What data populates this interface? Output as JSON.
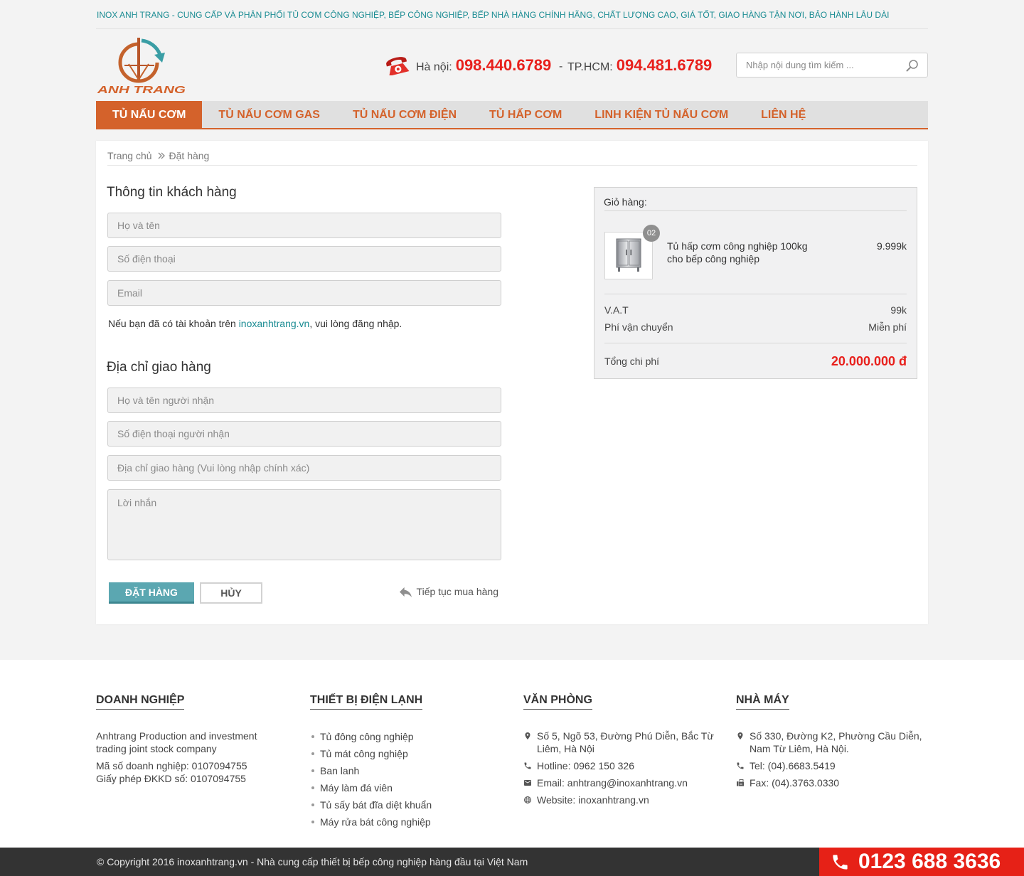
{
  "tagline": "INOX ANH TRANG - CUNG CẤP VÀ PHÂN PHỐI TỦ CƠM CÔNG NGHIỆP, BẾP CÔNG NGHIỆP, BẾP NHÀ HÀNG CHÍNH HÃNG, CHẤT LƯỢNG CAO, GIÁ TỐT, GIAO HÀNG TẬN NƠI, BẢO HÀNH LÂU DÀI",
  "logo": {
    "text": "ANH TRANG",
    "icon": "anh-trang-logo"
  },
  "header": {
    "phone_icon": "red-telephone-icon",
    "hotlines": [
      {
        "label": "Hà nội:",
        "number": "098.440.6789"
      },
      {
        "label": "TP.HCM:",
        "number": "094.481.6789"
      }
    ],
    "separator": "-",
    "search": {
      "placeholder": "Nhập nội dung tìm kiếm ...",
      "value": "",
      "icon": "search-icon"
    }
  },
  "nav": {
    "items": [
      {
        "label": "TỦ NẤU CƠM",
        "active": true
      },
      {
        "label": "TỦ NẤU CƠM GAS",
        "active": false
      },
      {
        "label": "TỦ NẤU CƠM ĐIỆN",
        "active": false
      },
      {
        "label": "TỦ HẤP CƠM",
        "active": false
      },
      {
        "label": "LINH KIỆN TỦ NẤU CƠM",
        "active": false
      },
      {
        "label": "LIÊN HỆ",
        "active": false
      }
    ]
  },
  "breadcrumb": {
    "items": [
      "Trang chủ",
      "Đặt hàng"
    ],
    "separator_icon": "double-chevron-right-icon"
  },
  "customer_info": {
    "title": "Thông tin khách hàng",
    "fields": [
      {
        "placeholder": "Họ và tên",
        "value": ""
      },
      {
        "placeholder": "Số điện thoại",
        "value": ""
      },
      {
        "placeholder": "Email",
        "value": ""
      }
    ],
    "login_note": {
      "before": "Nếu bạn đã có tài khoản trên ",
      "link": "inoxanhtrang.vn",
      "after": ", vui lòng đăng nhập."
    }
  },
  "shipping_address": {
    "title": "Địa chỉ giao hàng",
    "fields": [
      {
        "placeholder": "Họ và tên người nhận",
        "value": ""
      },
      {
        "placeholder": "Số điện thoại người nhận",
        "value": ""
      },
      {
        "placeholder": "Địa chỉ giao hàng (Vui lòng nhập chính xác)",
        "value": ""
      },
      {
        "placeholder": "Lời nhắn",
        "value": ""
      }
    ]
  },
  "actions": {
    "order_label": "ĐẶT HÀNG",
    "cancel_label": "HỦY",
    "continue_label": "Tiếp tục mua hàng",
    "continue_icon": "reply-arrow-icon"
  },
  "cart": {
    "title": "Giỏ hàng:",
    "items": [
      {
        "quantity": "02",
        "name": "Tủ hấp cơm công nghiệp 100kg cho bếp công nghiệp",
        "price": "9.999k",
        "image_icon": "steamer-cabinet-icon"
      }
    ],
    "summary": [
      {
        "label": "V.A.T",
        "value": "99k"
      },
      {
        "label": "Phí vận chuyển",
        "value": "Miễn phí"
      }
    ],
    "total": {
      "label": "Tổng chi phí",
      "value": "20.000.000 đ"
    }
  },
  "footer": {
    "company": {
      "title": "DOANH NGHIỆP",
      "name": "Anhtrang Production and investment trading joint stock company",
      "tax_code": "Mã số doanh nghiệp: 0107094755",
      "license": "Giấy phép ĐKKD số: 0107094755"
    },
    "refrigeration": {
      "title": "THIẾT BỊ ĐIỆN LẠNH",
      "items": [
        "Tủ đông công nghiệp",
        "Tủ mát công nghiệp",
        "Ban lanh",
        "Máy làm đá viên",
        "Tủ sấy bát đĩa diệt khuẩn",
        "Máy rửa bát công nghiệp"
      ]
    },
    "office": {
      "title": "VĂN PHÒNG",
      "items": [
        {
          "icon": "map-marker-icon",
          "text": "Số 5, Ngõ 53, Đường Phú Diễn, Bắc Từ Liêm, Hà Nội"
        },
        {
          "icon": "phone-icon",
          "text": "Hotline: 0962 150 326"
        },
        {
          "icon": "envelope-icon",
          "text": "Email: anhtrang@inoxanhtrang.vn"
        },
        {
          "icon": "globe-icon",
          "text": "Website: inoxanhtrang.vn"
        }
      ]
    },
    "factory": {
      "title": "NHÀ MÁY",
      "items": [
        {
          "icon": "map-marker-icon",
          "text": "Số 330, Đường K2, Phường Cầu Diễn, Nam Từ Liêm, Hà Nội."
        },
        {
          "icon": "phone-icon",
          "text": "Tel: (04).6683.5419"
        },
        {
          "icon": "fax-icon",
          "text": "Fax: (04).3763.0330"
        }
      ]
    },
    "copyright": "© Copyright 2016 inoxanhtrang.vn - Nhà cung cấp thiết bị bếp công nghiệp hàng đầu tại Việt Nam",
    "hotline": {
      "icon": "phone-icon",
      "number": "0123 688 3636"
    }
  },
  "colors": {
    "accent": "#d4622b",
    "teal": "#1b8c93",
    "button": "#5ba7b1",
    "red": "#e8201c",
    "hot": "#e62117",
    "dark": "#333333"
  }
}
